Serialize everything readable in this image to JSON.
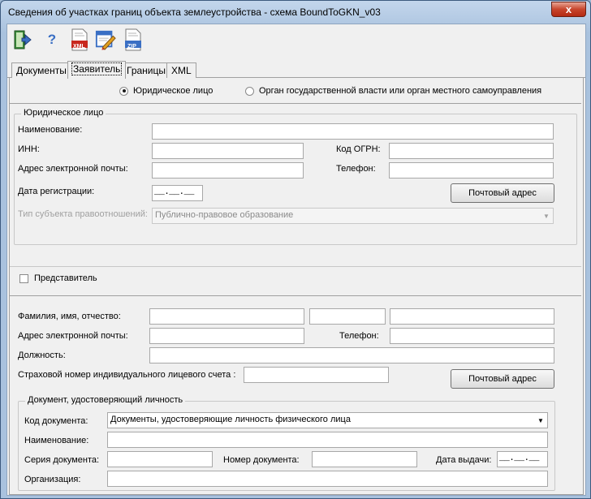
{
  "window": {
    "title": "Сведения об участках границ объекта землеустройства - схема BoundToGKN_v03",
    "close_glyph": "x"
  },
  "toolbar": {
    "buttons": [
      {
        "name": "exit-icon"
      },
      {
        "name": "help-icon",
        "glyph": "?"
      },
      {
        "name": "xml-file-icon",
        "text": "XML"
      },
      {
        "name": "edit-icon"
      },
      {
        "name": "zip-file-icon",
        "text": "ZIP"
      }
    ]
  },
  "tabs": [
    "Документы",
    "Заявитель",
    "Границы",
    "XML"
  ],
  "radio": {
    "legal": "Юридическое лицо",
    "government": "Орган государственной власти или орган местного самоуправления"
  },
  "legal_entity": {
    "legend": "Юридическое лицо",
    "name_label": "Наименование:",
    "inn_label": "ИНН:",
    "ogrn_label": "Код ОГРН:",
    "email_label": "Адрес электронной почты:",
    "phone_label": "Телефон:",
    "reg_date_label": "Дата регистрации:",
    "reg_date_mask": "__.__.__",
    "postal_button": "Почтовый адрес",
    "subject_type_label": "Тип субъекта правоотношений:",
    "subject_type_value": "Публично-правовое образование"
  },
  "representative": {
    "checkbox_label": "Представитель",
    "fio_label": "Фамилия, имя, отчество:",
    "email_label": "Адрес электронной почты:",
    "phone_label": "Телефон:",
    "position_label": "Должность:",
    "snils_label": "Страховой номер индивидуального лицевого счета :",
    "postal_button": "Почтовый адрес"
  },
  "identity_doc": {
    "legend": "Документ, удостоверяющий личность",
    "code_label": "Код документа:",
    "code_value": "Документы, удостоверяющие личность физического лица",
    "name_label": "Наименование:",
    "series_label": "Серия документа:",
    "number_label": "Номер документа:",
    "issue_date_label": "Дата выдачи:",
    "issue_date_mask": "__.__.__",
    "org_label": "Организация:"
  }
}
